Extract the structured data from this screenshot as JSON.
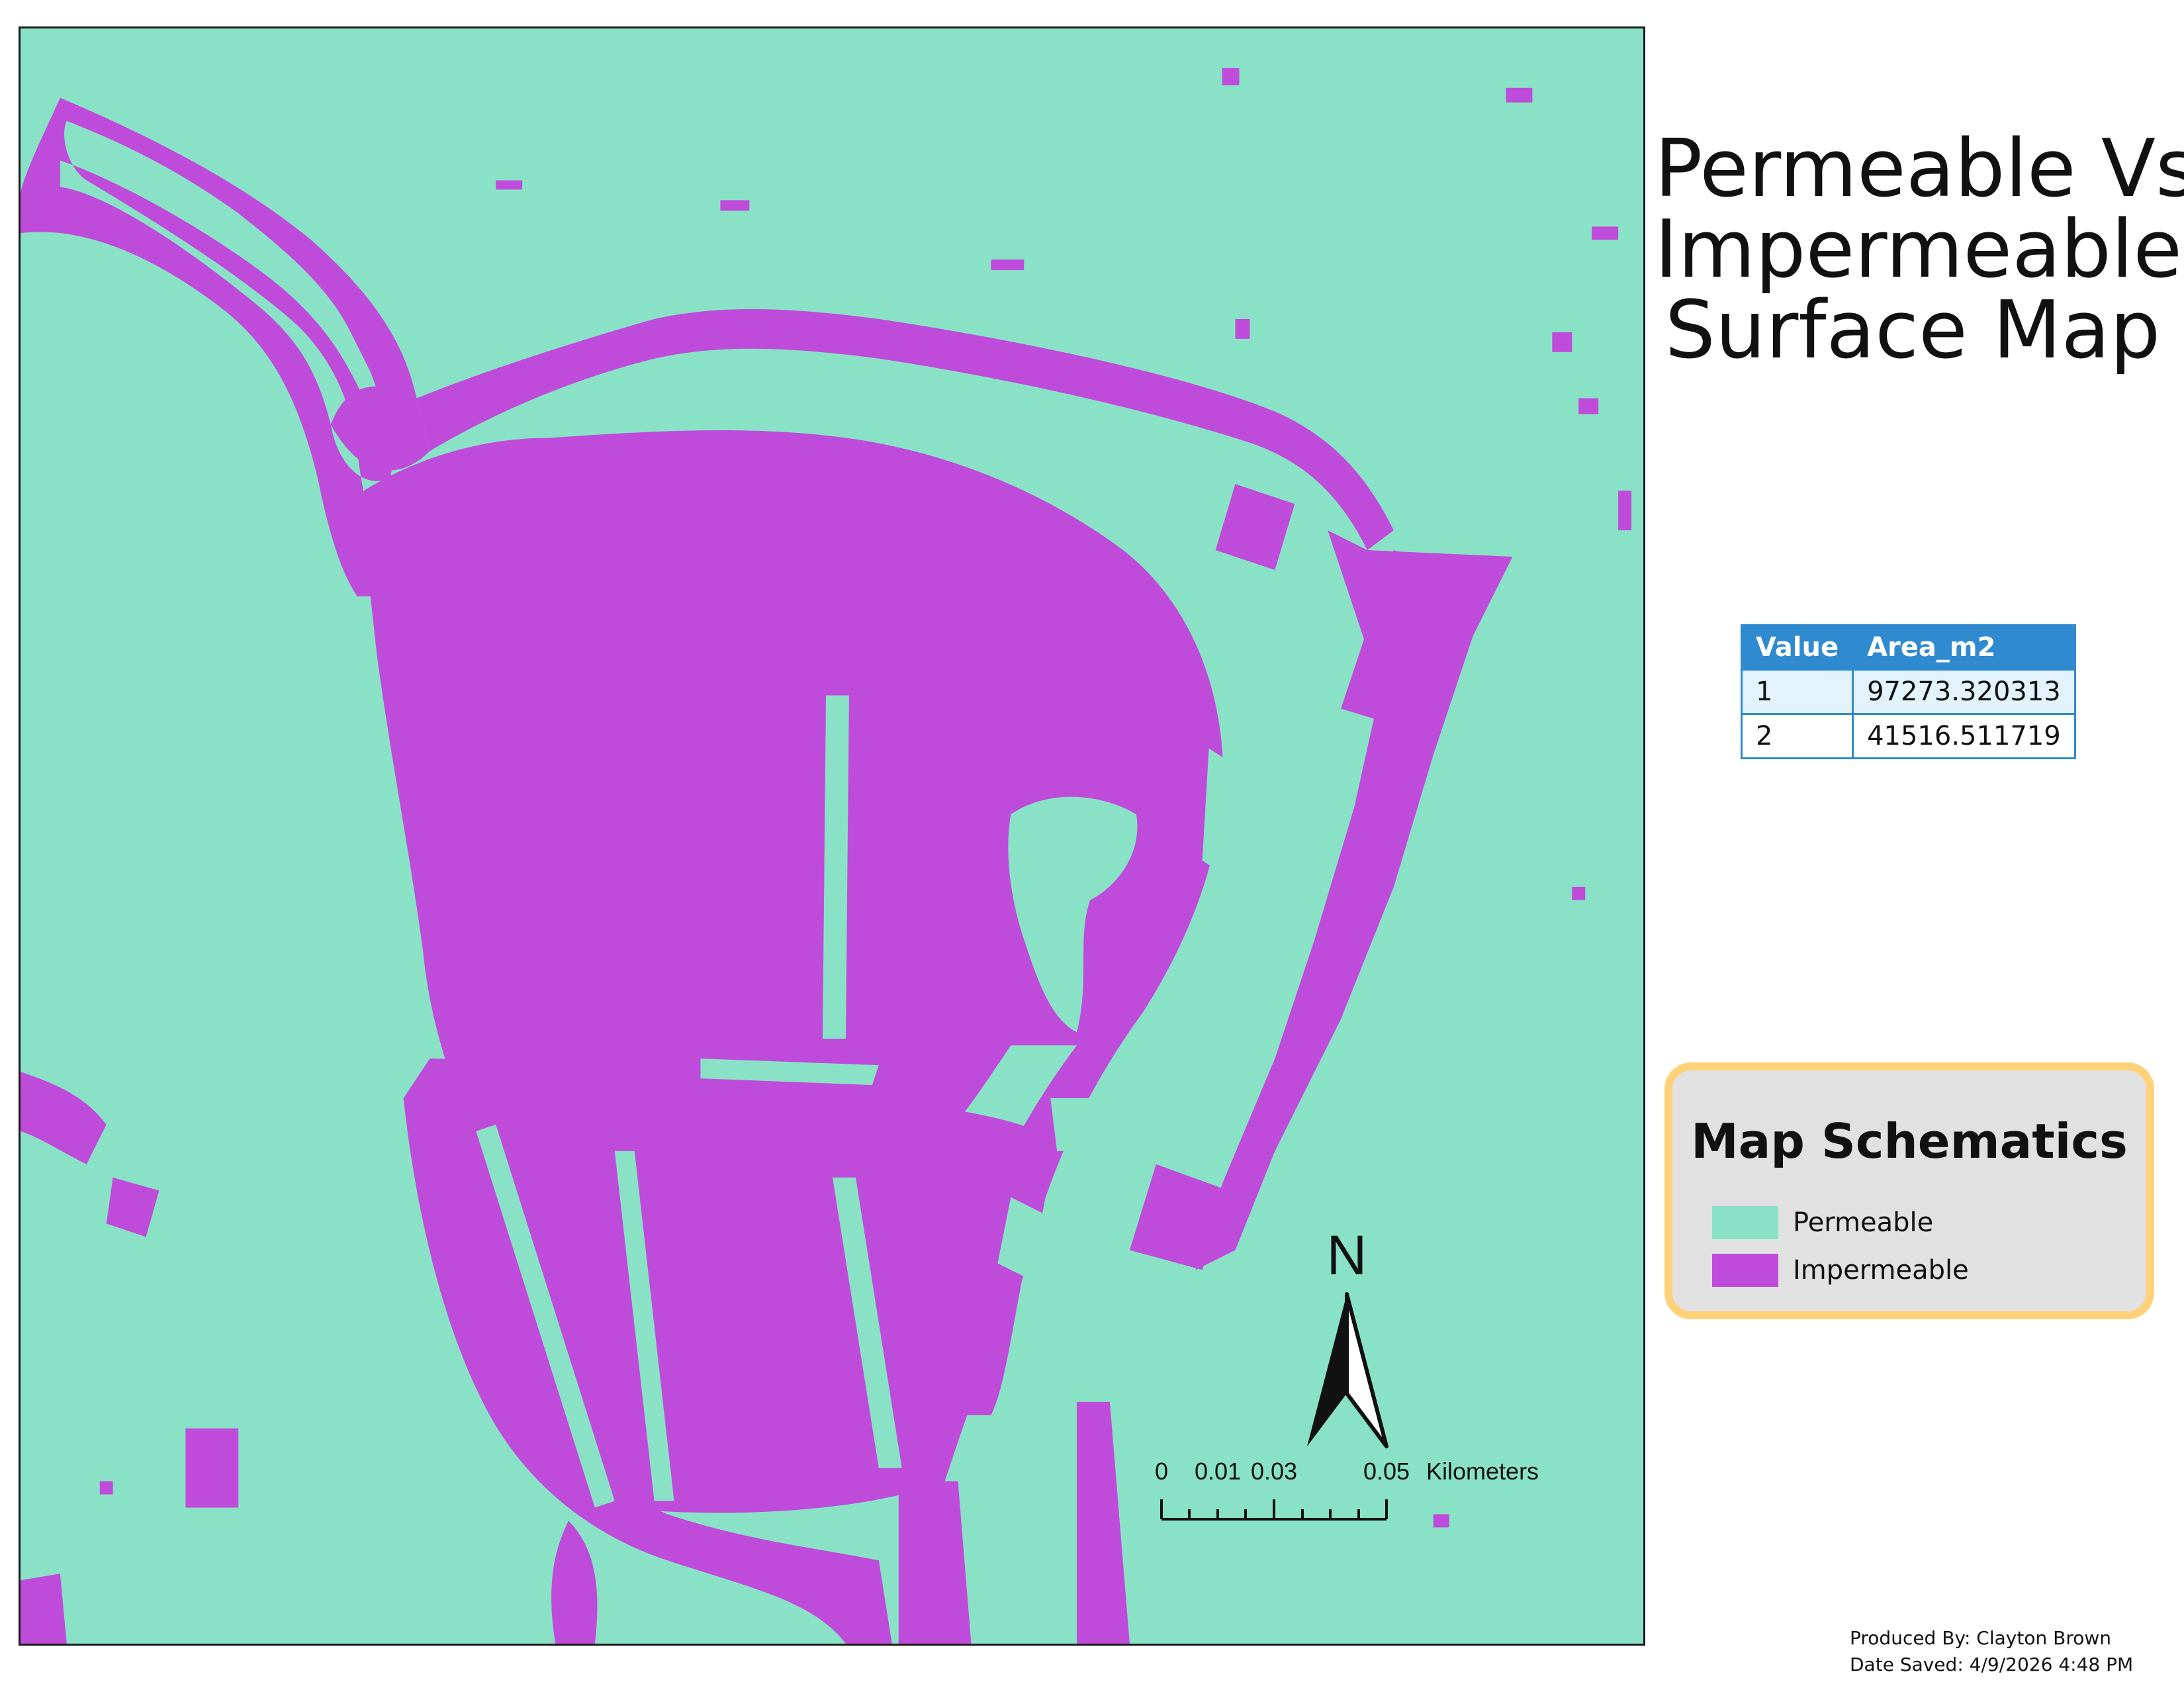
{
  "title": {
    "line1": "Permeable Vs.",
    "line2": "Impermeable",
    "line3": "Surface Map"
  },
  "colors": {
    "permeable": "#8ae2c6",
    "impermeable": "#bf4bda",
    "table_header": "#2f8ad0",
    "legend_border": "#ffd27a",
    "legend_background": "#e1e1e1"
  },
  "area_table": {
    "headers": [
      "Value",
      "Area_m2"
    ],
    "rows": [
      [
        "1",
        "97273.320313"
      ],
      [
        "2",
        "41516.511719"
      ]
    ]
  },
  "legend": {
    "title": "Map Schematics",
    "items": [
      {
        "label": "Permeable",
        "color": "#8ae2c6"
      },
      {
        "label": "Impermeable",
        "color": "#bf4bda"
      }
    ]
  },
  "north_arrow": {
    "label": "N",
    "icon": "north-arrow-icon"
  },
  "scale_bar": {
    "labels": [
      "0",
      "0.01",
      "0.03",
      "0.05"
    ],
    "units": "Kilometers"
  },
  "credits": {
    "produced_by": "Produced By: Clayton Brown",
    "date_saved": "Date Saved: 4/9/2026 4:48 PM"
  }
}
